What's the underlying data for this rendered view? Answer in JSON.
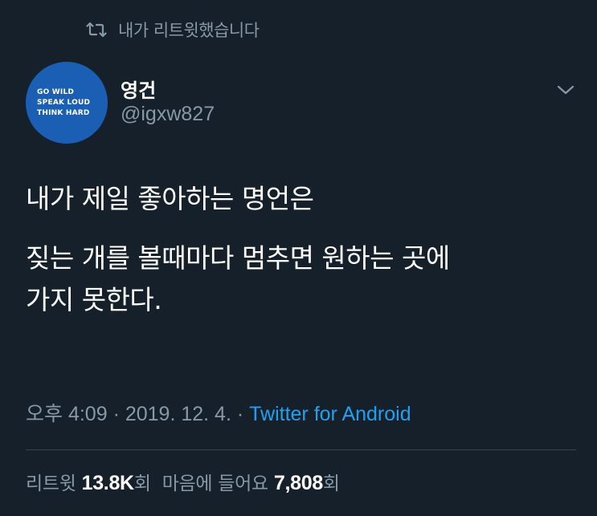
{
  "retweet_context": {
    "icon": "retweet-icon",
    "text": "내가 리트윗했습니다"
  },
  "author": {
    "avatar_lines": [
      "GO WILD",
      "SPEAK LOUD",
      "THINK HARD"
    ],
    "avatar_color": "#1a5fb4",
    "display_name": "영건",
    "handle": "@igxw827"
  },
  "menu": {
    "icon": "chevron-down-icon"
  },
  "tweet": {
    "line1": "내가 제일 좋아하는 명언은",
    "line2": "짖는 개를 볼때마다 멈추면 원하는 곳에",
    "line3": "가지 못한다."
  },
  "meta": {
    "time": "오후 4:09",
    "separator": "·",
    "date": "2019. 12. 4.",
    "source": "Twitter for Android"
  },
  "stats": {
    "retweets_label": "리트윗",
    "retweets_count": "13.8K",
    "retweets_suffix": "회",
    "likes_label": "마음에 들어요",
    "likes_count": "7,808",
    "likes_suffix": "회"
  },
  "colors": {
    "background": "#15202b",
    "text_primary": "#ffffff",
    "text_secondary": "#8899a6",
    "accent": "#1da1f2",
    "divider": "#38444d"
  }
}
